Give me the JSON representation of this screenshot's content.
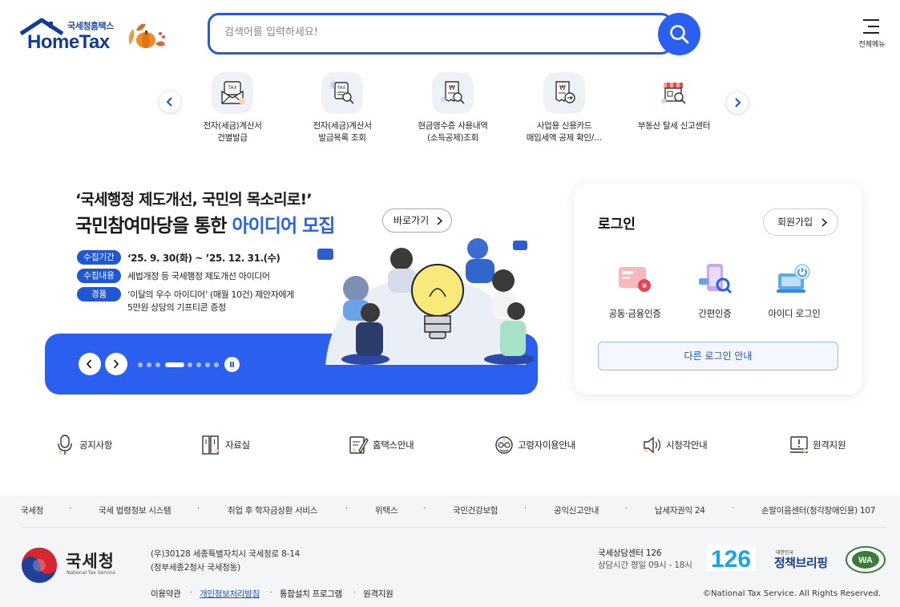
{
  "header": {
    "logo_sub": "국세청홈택스",
    "logo_main": "HomeTax",
    "search_placeholder": "검색어를 입력하세요!",
    "menu_label": "전체메뉴"
  },
  "quick_menu": [
    {
      "label": "전자(세금)계산서\n건별발급",
      "icon": "tax-invoice-icon"
    },
    {
      "label": "전자(세금)계산서\n발급목록 조회",
      "icon": "invoice-search-icon"
    },
    {
      "label": "현금영수증 사용내역\n(소득공제)조회",
      "icon": "receipt-search-icon"
    },
    {
      "label": "사업용 신용카드\n매입세액 공제 확인/…",
      "icon": "card-check-icon"
    },
    {
      "label": "부동산 탈세 신고센터",
      "icon": "store-search-icon"
    }
  ],
  "banner": {
    "headline1": "‘국세행정 제도개선, 국민의 목소리로!’",
    "headline2_prefix": "국민참여마당을 통한 ",
    "headline2_highlight": "아이디어 모집",
    "cta": "바로가기",
    "rows": [
      {
        "tag": "수집기간",
        "text": "‘25. 9. 30(화) ~ ’25. 12. 31.(수)",
        "text2": ""
      },
      {
        "tag": "수집내용",
        "text": "세법개정 등 국세행정 제도개선 아이디어",
        "text2": ""
      },
      {
        "tag": "경품",
        "text": "‘이달의 우수 아이디어’ (매월 10건) 제안자에게",
        "text2": "5만원 상당의 기프티콘 증정"
      }
    ],
    "slide_count": 8,
    "active_slide": 3
  },
  "login": {
    "title": "로그인",
    "join": "회원가입",
    "options": [
      {
        "label": "공동·금융인증",
        "icon": "certificate-icon"
      },
      {
        "label": "간편인증",
        "icon": "simple-auth-icon"
      },
      {
        "label": "아이디 로그인",
        "icon": "id-login-icon"
      }
    ],
    "other": "다른 로그인 안내"
  },
  "quick_links": [
    {
      "label": "공지사항",
      "icon": "microphone-icon"
    },
    {
      "label": "자료실",
      "icon": "archive-icon"
    },
    {
      "label": "홈택스안내",
      "icon": "guide-icon"
    },
    {
      "label": "고령자이용안내",
      "icon": "senior-icon"
    },
    {
      "label": "시청각안내",
      "icon": "speaker-icon"
    },
    {
      "label": "원격지원",
      "icon": "remote-support-icon"
    }
  ],
  "footer": {
    "links": [
      "국세청",
      "국세 법령정보 시스템",
      "취업 후 학자금상환 서비스",
      "위택스",
      "국민건강보험",
      "공익신고안내",
      "납세자권익 24",
      "손말이음센터(청각장애인용) 107"
    ],
    "org": "국세청",
    "org_en": "National Tax Service",
    "address1": "(우)30128 세종특별자치시 국세청로 8-14",
    "address2": "(정부세종2청사 국세청동)",
    "bottom_links": [
      "이용약관",
      "개인정보처리방침",
      "통합설치 프로그램",
      "원격지원"
    ],
    "call_center": "국세상담센터 126",
    "call_hours": "상담시간 평일 09시 - 18시",
    "badge_126": "126",
    "brief_small": "대한민국",
    "brief_main": "정책브리핑",
    "wa_label": "WA",
    "copyright": "©National Tax Service. All Rights Reserved.",
    "brand_blue": "#2a5ff0"
  }
}
